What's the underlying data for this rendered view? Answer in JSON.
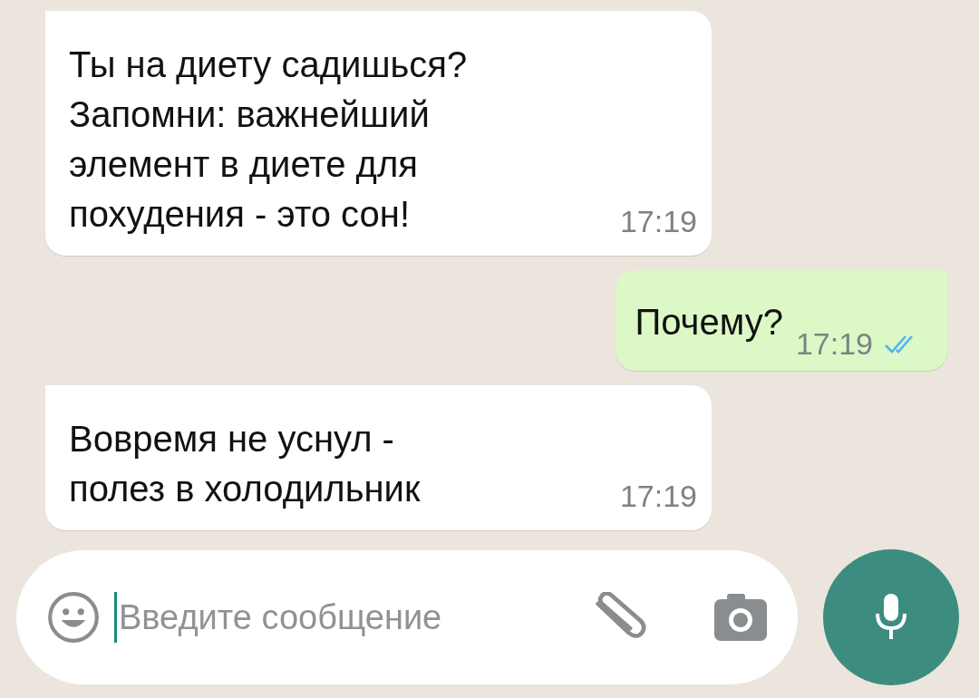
{
  "messages": [
    {
      "kind": "incoming",
      "text": "Ты на диету садишься?\nЗапомни: важнейший\nэлемент в диете для\nпохудения - это сон!",
      "time": "17:19"
    },
    {
      "kind": "outgoing",
      "text": "Почему?",
      "time": "17:19",
      "read": true
    },
    {
      "kind": "incoming",
      "text": "Вовремя не уснул -\nполез в холодильник",
      "time": "17:19"
    }
  ],
  "composer": {
    "placeholder": "Введите сообщение"
  }
}
